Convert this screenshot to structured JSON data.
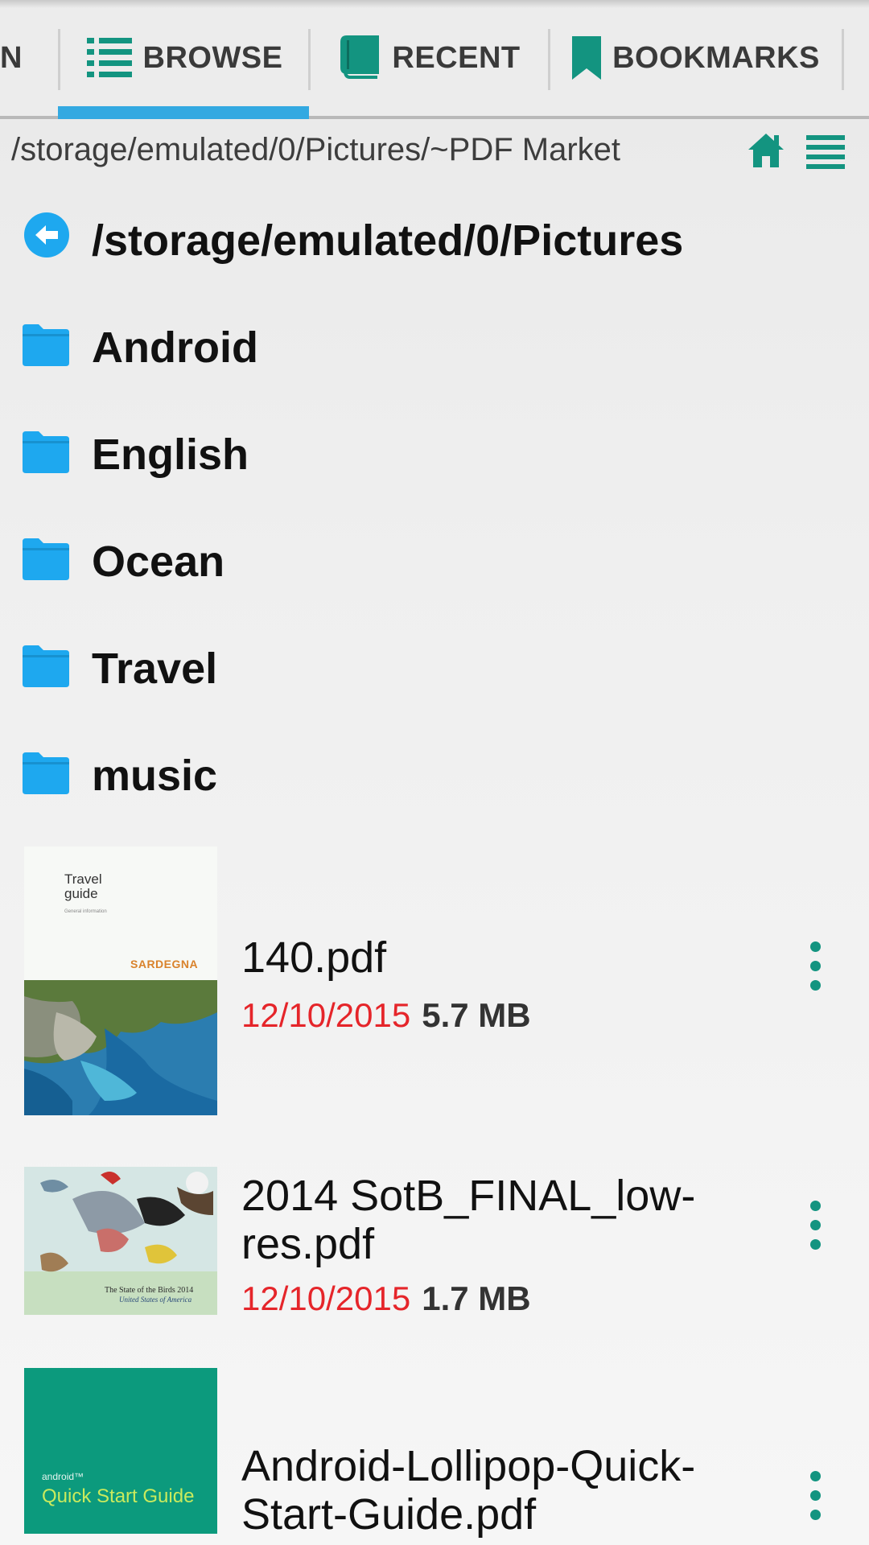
{
  "colors": {
    "accent": "#139480",
    "folder": "#1ea8ef",
    "tab_indicator": "#33a9e1",
    "date": "#e5252a"
  },
  "tabs": [
    {
      "label": "N",
      "icon": "none"
    },
    {
      "label": "BROWSE",
      "icon": "list-icon",
      "selected": true
    },
    {
      "label": "RECENT",
      "icon": "book-icon"
    },
    {
      "label": "BOOKMARKS",
      "icon": "bookmark-icon"
    }
  ],
  "pathbar": {
    "path": "/storage/emulated/0/Pictures/~PDF Market",
    "home_icon": "home-icon",
    "menu_icon": "list-menu-icon"
  },
  "parent": {
    "label": "/storage/emulated/0/Pictures",
    "icon": "back-arrow-icon"
  },
  "folders": [
    {
      "label": "Android"
    },
    {
      "label": "English"
    },
    {
      "label": "Ocean"
    },
    {
      "label": "Travel"
    },
    {
      "label": "music"
    }
  ],
  "files": [
    {
      "name": "140.pdf",
      "date": "12/10/2015",
      "size": "5.7 MB",
      "thumb": {
        "title_line1": "Travel",
        "title_line2": "guide",
        "subtitle": "General information",
        "brand": "SARDEGNA"
      }
    },
    {
      "name": "2014 SotB_FINAL_low-res.pdf",
      "date": "12/10/2015",
      "size": "1.7 MB",
      "thumb": {
        "title": "The State of the Birds 2014",
        "subtitle": "United States of America"
      }
    },
    {
      "name": "Android-Lollipop-Quick-Start-Guide.pdf",
      "thumb": {
        "brand": "android™",
        "title": "Quick Start Guide"
      }
    }
  ]
}
